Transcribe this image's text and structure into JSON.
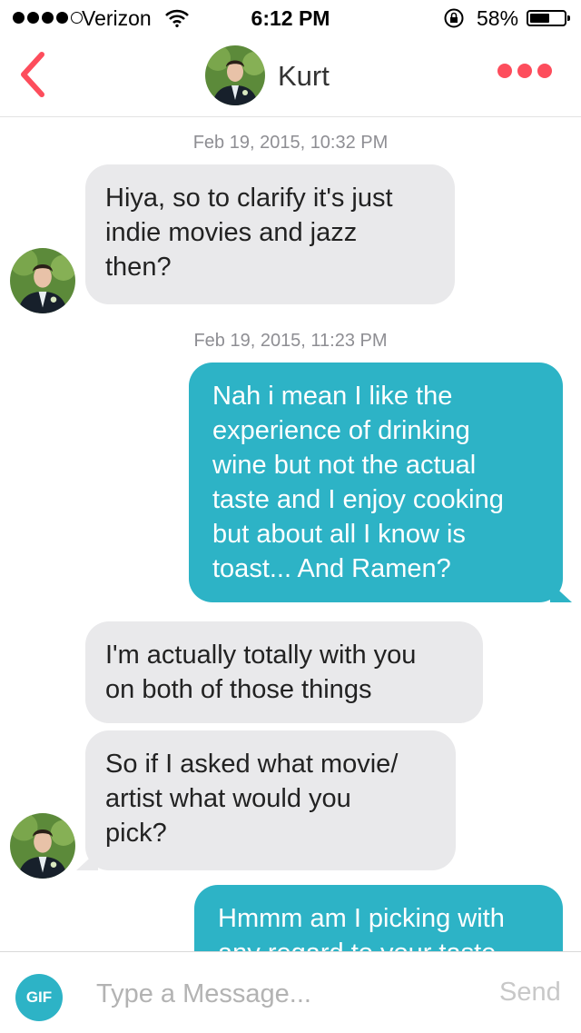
{
  "status_bar": {
    "carrier": "Verizon",
    "time": "6:12 PM",
    "battery_percent": "58%",
    "battery_level": 0.58,
    "signal_bars": 4,
    "icons": [
      "signal-dots-icon",
      "wifi-icon",
      "rotation-lock-icon",
      "battery-icon"
    ]
  },
  "header": {
    "back_icon": "chevron-left-icon",
    "contact_name": "Kurt",
    "more_icon": "more-dots-icon",
    "accent_color": "#fd4d5c"
  },
  "conversation": {
    "messages": [
      {
        "type": "timestamp",
        "text": "Feb 19, 2015, 10:32 PM"
      },
      {
        "type": "incoming",
        "lines": [
          "Hiya, so to clarify it's just",
          "indie movies and jazz",
          "then?"
        ]
      },
      {
        "type": "timestamp",
        "text": "Feb 19, 2015, 11:23 PM"
      },
      {
        "type": "outgoing",
        "lines": [
          "Nah i mean I like the",
          "experience of drinking",
          "wine but not the actual",
          "taste and I enjoy cooking",
          "but about all I know is",
          "toast... And Ramen?"
        ]
      },
      {
        "type": "incoming",
        "lines": [
          "I'm actually totally with you",
          "on both of those things"
        ]
      },
      {
        "type": "incoming",
        "lines": [
          "So if I asked what movie/",
          "artist what would you",
          "pick?"
        ]
      },
      {
        "type": "outgoing",
        "lines": [
          "Hmmm am I picking with",
          "any regard to your taste"
        ]
      }
    ],
    "incoming_color": "#e9e9eb",
    "outgoing_color": "#2db3c6"
  },
  "input_bar": {
    "gif_label": "GIF",
    "placeholder": "Type a Message...",
    "send_label": "Send"
  }
}
